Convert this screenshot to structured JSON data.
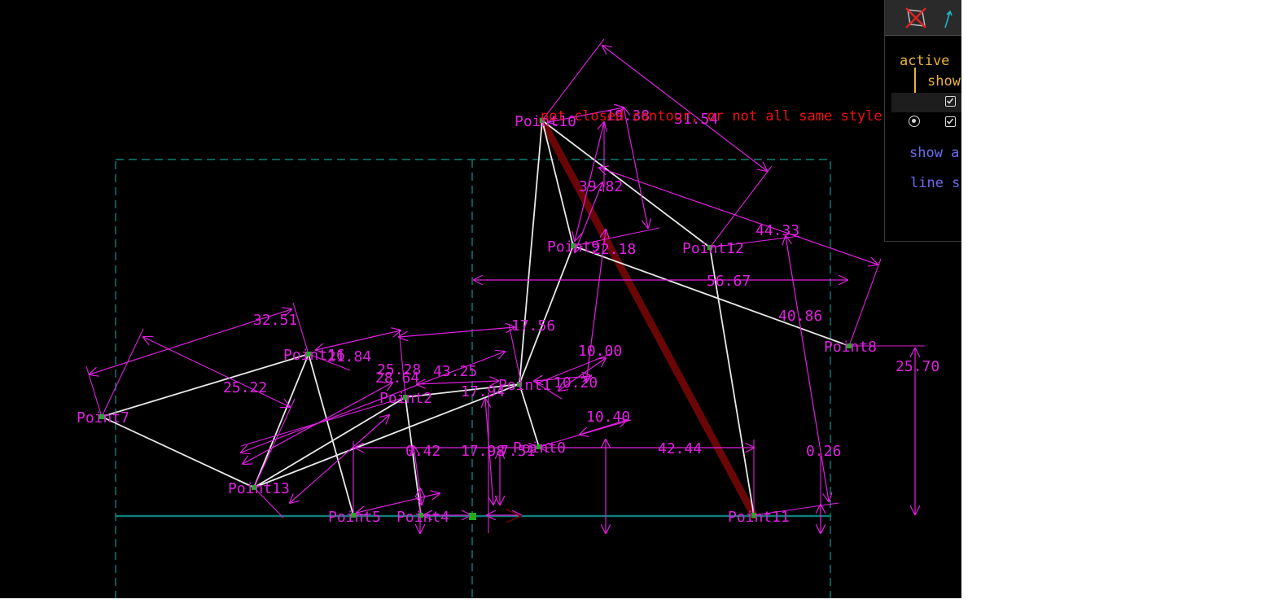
{
  "window": {
    "colors": {
      "background": "#000000",
      "dimension": "#e020e0",
      "contour": "#e8e8e8",
      "frame": "#0e7f78",
      "error": "#ee1111",
      "highlight": "#6a0606",
      "node": "#22aa22"
    }
  },
  "canvas": {
    "error_message": "not closed contour, or not all same style",
    "points": [
      {
        "id": "p10",
        "label": "Point10"
      },
      {
        "id": "p9",
        "label": "Point9"
      },
      {
        "id": "p12",
        "label": "Point12"
      },
      {
        "id": "p8",
        "label": "Point8"
      },
      {
        "id": "p1",
        "label": "Point1"
      },
      {
        "id": "p0",
        "label": "Point0"
      },
      {
        "id": "p2",
        "label": "Point2"
      },
      {
        "id": "p16",
        "label": "Point16"
      },
      {
        "id": "p7",
        "label": "Point7"
      },
      {
        "id": "p13",
        "label": "Point13"
      },
      {
        "id": "p5",
        "label": "Point5"
      },
      {
        "id": "p4",
        "label": "Point4"
      },
      {
        "id": "p11",
        "label": "Point11"
      }
    ],
    "dimensions": [
      {
        "id": "d1",
        "value": "19.38"
      },
      {
        "id": "d2",
        "value": "31.54"
      },
      {
        "id": "d3",
        "value": "39.82"
      },
      {
        "id": "d4",
        "value": "22.18"
      },
      {
        "id": "d5",
        "value": "44.33"
      },
      {
        "id": "d6",
        "value": "56.67"
      },
      {
        "id": "d7",
        "value": "40.86"
      },
      {
        "id": "d8",
        "value": "25.70"
      },
      {
        "id": "d9",
        "value": "32.51"
      },
      {
        "id": "d10",
        "value": "21.84"
      },
      {
        "id": "d11",
        "value": "17.56"
      },
      {
        "id": "d12",
        "value": "25.22"
      },
      {
        "id": "d13",
        "value": "25.28"
      },
      {
        "id": "d14",
        "value": "28.64"
      },
      {
        "id": "d15",
        "value": "43.25"
      },
      {
        "id": "d16",
        "value": "17.94"
      },
      {
        "id": "d17",
        "value": "10.00"
      },
      {
        "id": "d18",
        "value": "10.20"
      },
      {
        "id": "d19",
        "value": "10.40"
      },
      {
        "id": "d20",
        "value": "42.44"
      },
      {
        "id": "d21",
        "value": "0.26"
      },
      {
        "id": "d22",
        "value": "0.42"
      },
      {
        "id": "d23",
        "value": "17.98"
      },
      {
        "id": "d24",
        "value": "7.51"
      }
    ]
  },
  "panel": {
    "active_label": "active",
    "show_label": "show",
    "show_all_label": "show a",
    "line_style_label": "line s",
    "tool_1_icon": "crossed-sketch-icon",
    "tool_2_icon": "cyan-arrow-icon"
  }
}
